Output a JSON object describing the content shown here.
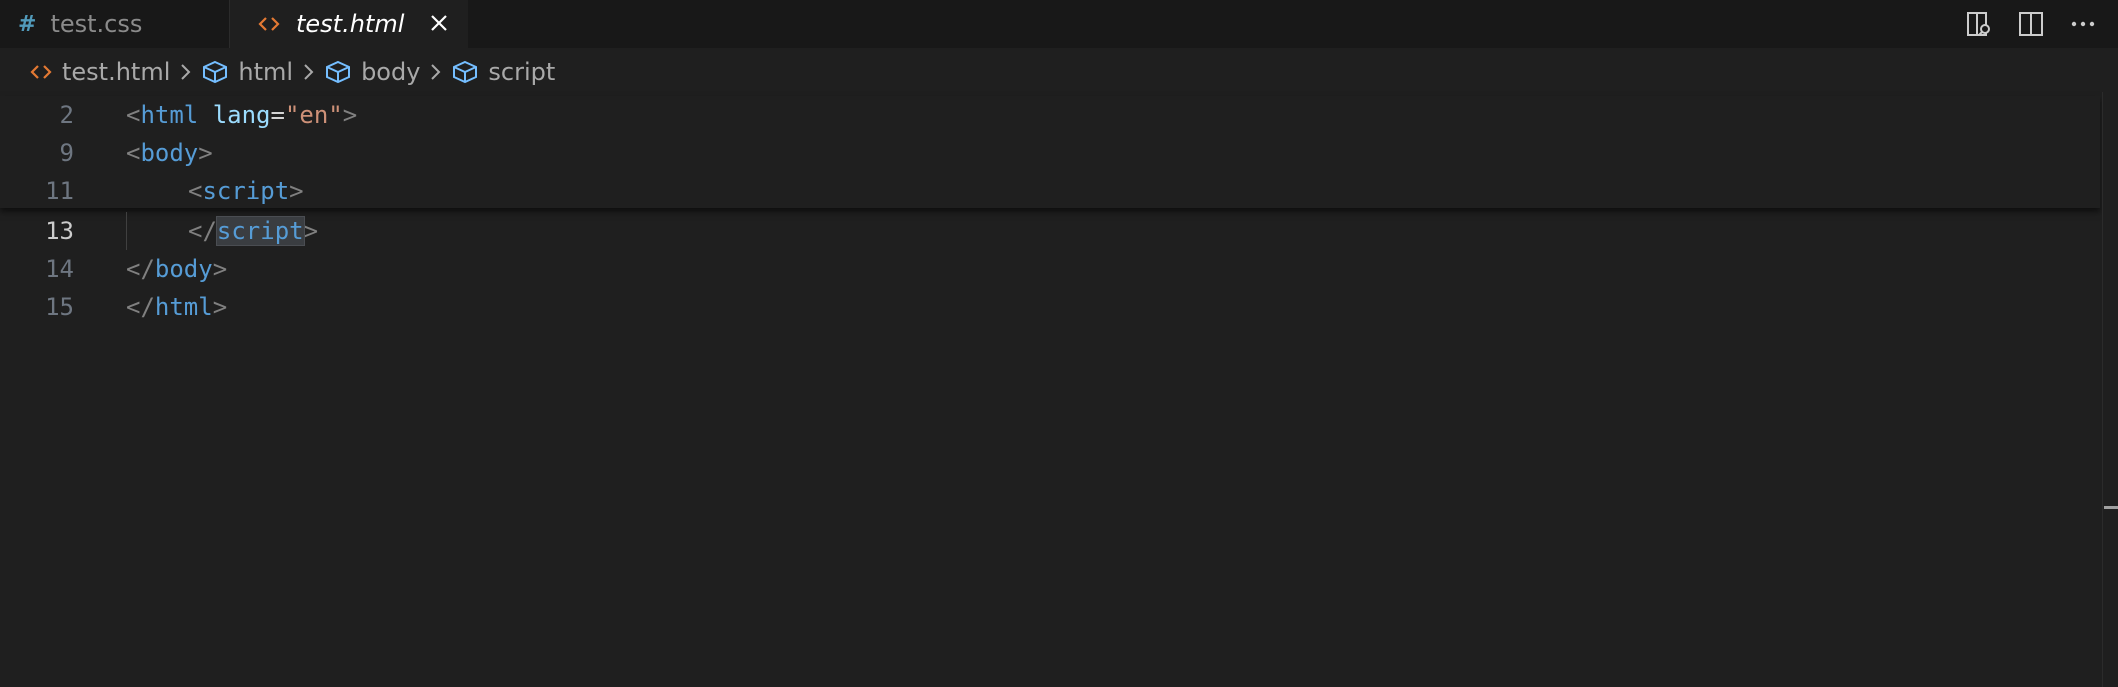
{
  "tabs": [
    {
      "label": "test.css",
      "icon": "hash-icon",
      "active": false
    },
    {
      "label": "test.html",
      "icon": "html-code-icon",
      "active": true
    }
  ],
  "tab_actions": [
    "open-preview-icon",
    "split-editor-icon",
    "more-actions-icon"
  ],
  "breadcrumb": [
    {
      "label": "test.html",
      "icon": "html-code-icon"
    },
    {
      "label": "html",
      "icon": "cube-icon"
    },
    {
      "label": "body",
      "icon": "cube-icon"
    },
    {
      "label": "script",
      "icon": "cube-icon"
    }
  ],
  "editor": {
    "current_line": "13",
    "lines": [
      {
        "number": "2",
        "lt": "<",
        "tag": "html",
        "attr": "lang",
        "eq": "=",
        "value": "\"en\"",
        "gt": ">"
      },
      {
        "number": "9",
        "lt": "<",
        "tag": "body",
        "gt": ">"
      },
      {
        "number": "11",
        "lt": "<",
        "tag": "script",
        "gt": ">"
      },
      {
        "number": "13",
        "lt": "</",
        "tag": "script",
        "gt": ">"
      },
      {
        "number": "14",
        "lt": "</",
        "tag": "body",
        "gt": ">"
      },
      {
        "number": "15",
        "lt": "</",
        "tag": "html",
        "gt": ">"
      }
    ]
  },
  "colors": {
    "background": "#1f1f1f",
    "tab_bar": "#181818",
    "tag": "#569cd6",
    "attribute": "#9cdcfe",
    "string": "#ce9178",
    "punctuation": "#808080",
    "html_icon": "#e37933",
    "css_icon": "#519aba"
  }
}
